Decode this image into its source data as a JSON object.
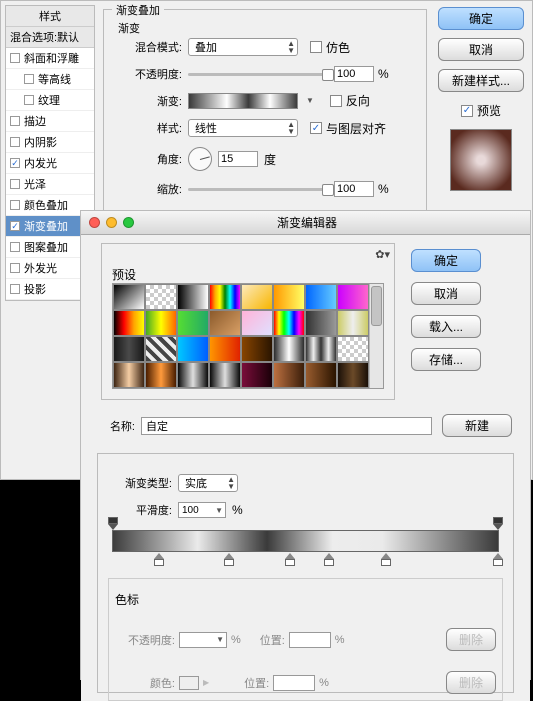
{
  "sidebar": {
    "header": "样式",
    "opts_header": "混合选项:默认",
    "items": [
      {
        "label": "斜面和浮雕",
        "checked": false
      },
      {
        "label": "等高线",
        "checked": false,
        "indent": true
      },
      {
        "label": "纹理",
        "checked": false,
        "indent": true
      },
      {
        "label": "描边",
        "checked": false
      },
      {
        "label": "内阴影",
        "checked": false
      },
      {
        "label": "内发光",
        "checked": true
      },
      {
        "label": "光泽",
        "checked": false
      },
      {
        "label": "颜色叠加",
        "checked": false
      },
      {
        "label": "渐变叠加",
        "checked": true,
        "selected": true
      },
      {
        "label": "图案叠加",
        "checked": false
      },
      {
        "label": "外发光",
        "checked": false
      },
      {
        "label": "投影",
        "checked": false
      }
    ]
  },
  "buttons": {
    "ok": "确定",
    "cancel": "取消",
    "new_style": "新建样式...",
    "preview_label": "预览"
  },
  "overlay": {
    "group_title": "渐变叠加",
    "sub_title": "渐变",
    "blend_label": "混合模式:",
    "blend_value": "叠加",
    "dither": "仿色",
    "opacity_label": "不透明度:",
    "opacity_value": "100",
    "pct": "%",
    "gradient_label": "渐变:",
    "reverse": "反向",
    "style_label": "样式:",
    "style_value": "线性",
    "align": "与图层对齐",
    "angle_label": "角度:",
    "angle_value": "15",
    "deg": "度",
    "scale_label": "缩放:",
    "scale_value": "100"
  },
  "editor": {
    "title": "渐变编辑器",
    "presets_label": "预设",
    "name_label": "名称:",
    "name_value": "自定",
    "new_btn": "新建",
    "ok": "确定",
    "cancel": "取消",
    "load": "载入...",
    "save": "存储...",
    "type_label": "渐变类型:",
    "type_value": "实底",
    "smooth_label": "平滑度:",
    "smooth_value": "100",
    "pct": "%",
    "stops_title": "色标",
    "op_label": "不透明度:",
    "pos_label": "位置:",
    "del": "删除",
    "color_label": "颜色:"
  },
  "swatch_colors": [
    "linear-gradient(135deg,#000,#fff)",
    "repeating-conic-gradient(#ccc 0 25%,#fff 0 50%) 0/8px 8px",
    "linear-gradient(90deg,#000,#fff)",
    "linear-gradient(90deg,red,orange,yellow,green,cyan,blue,magenta)",
    "linear-gradient(135deg,#fceabb,#f8b500)",
    "linear-gradient(90deg,#ff9900,#ffff66)",
    "linear-gradient(90deg,#0066ff,#66ccff)",
    "linear-gradient(90deg,#cc00ff,#ff66cc)",
    "linear-gradient(90deg,#000,red,orange,yellow)",
    "linear-gradient(90deg,#4a2,#ff0,#f60)",
    "linear-gradient(90deg,#5d3,#2a6)",
    "linear-gradient(135deg,#8b5a2b,#d9a066)",
    "linear-gradient(135deg,#ffb3d9,#e0e0ff)",
    "linear-gradient(90deg,red,yellow,lime,cyan,blue,magenta,red)",
    "linear-gradient(90deg,#333,#999)",
    "linear-gradient(90deg,#cc6,#eee,#cc6)",
    "linear-gradient(90deg,#181818,#4a4a4a,#181818)",
    "repeating-linear-gradient(45deg,#444 0 4px,#eee 4px 8px)",
    "linear-gradient(90deg,#00c8ff,#005eff)",
    "linear-gradient(90deg,#ff9500,#e02200)",
    "linear-gradient(90deg,#884400,#2a1500)",
    "linear-gradient(90deg,#2b2b2b,#fff,#2b2b2b)",
    "linear-gradient(90deg,#333,#eee,#333,#eee,#333)",
    "repeating-conic-gradient(#ccc 0 25%,#fff 0 50%) 0/8px 8px",
    "linear-gradient(90deg,#3d2412,#f4cda4,#3d2412)",
    "linear-gradient(90deg,#4a1d00,#ff9a3c,#4a1d00)",
    "linear-gradient(90deg,#0a0a0a,#dedede,#0a0a0a)",
    "linear-gradient(90deg,#0a0a0a,#dedede,#0a0a0a)",
    "linear-gradient(90deg,#7a0d3a,#1a0008)",
    "linear-gradient(90deg,#bd7040,#3a1e0a)",
    "linear-gradient(90deg,#995c2e,#2a1400)",
    "linear-gradient(90deg,#1b1008,#6b4a28,#1b1008)"
  ]
}
